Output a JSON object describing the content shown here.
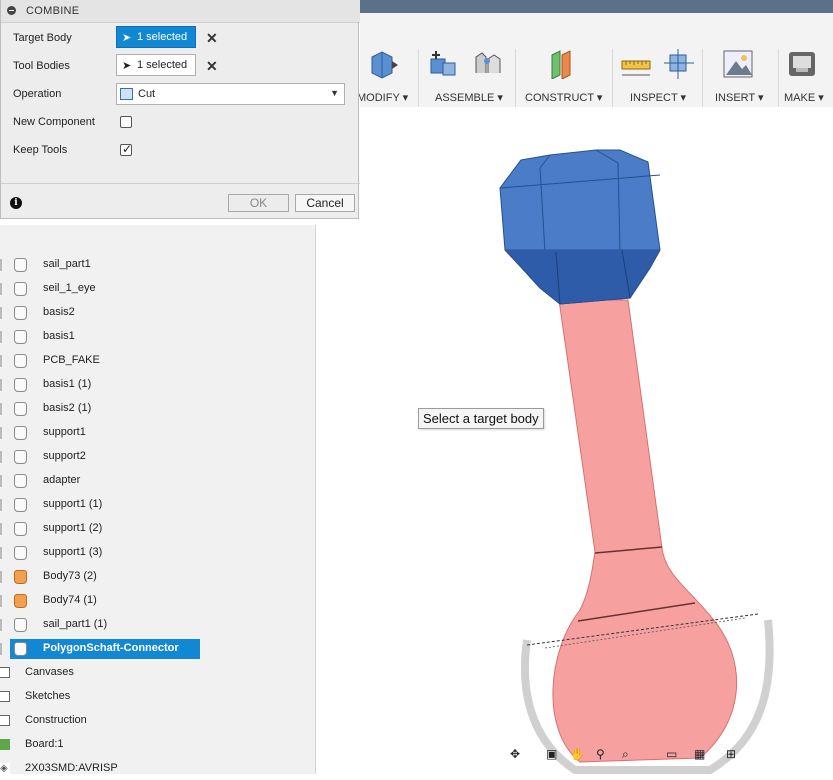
{
  "dialog": {
    "title": "COMBINE",
    "target_body_label": "Target Body",
    "target_body_value": "1 selected",
    "tool_bodies_label": "Tool Bodies",
    "tool_bodies_value": "1 selected",
    "operation_label": "Operation",
    "operation_value": "Cut",
    "new_component_label": "New Component",
    "new_component_checked": false,
    "keep_tools_label": "Keep Tools",
    "keep_tools_checked": true,
    "clear_glyph": "✕",
    "ok_label": "OK",
    "cancel_label": "Cancel",
    "info_glyph": "i"
  },
  "toolbar": {
    "groups": [
      "MODIFY ▾",
      "ASSEMBLE ▾",
      "CONSTRUCT ▾",
      "INSPECT ▾",
      "INSERT ▾",
      "MAKE ▾"
    ]
  },
  "viewport": {
    "tooltip": "Select a target body"
  },
  "browser": {
    "bodies": [
      {
        "label": "sail_part1",
        "icon": "body-icon"
      },
      {
        "label": "seil_1_eye",
        "icon": "body-icon"
      },
      {
        "label": "basis2",
        "icon": "body-icon"
      },
      {
        "label": "basis1",
        "icon": "body-icon"
      },
      {
        "label": "PCB_FAKE",
        "icon": "body-icon"
      },
      {
        "label": "basis1 (1)",
        "icon": "body-icon"
      },
      {
        "label": "basis2 (1)",
        "icon": "body-icon"
      },
      {
        "label": "support1",
        "icon": "body-icon"
      },
      {
        "label": "support2",
        "icon": "body-icon"
      },
      {
        "label": "adapter",
        "icon": "body-icon"
      },
      {
        "label": "support1 (1)",
        "icon": "body-icon"
      },
      {
        "label": "support1 (2)",
        "icon": "body-icon"
      },
      {
        "label": "support1 (3)",
        "icon": "body-icon"
      },
      {
        "label": "Body73 (2)",
        "icon": "orange-body-icon"
      },
      {
        "label": "Body74 (1)",
        "icon": "orange-body-icon"
      },
      {
        "label": "sail_part1 (1)",
        "icon": "body-icon"
      },
      {
        "label": "PolygonSchaft-Connector",
        "icon": "body-icon",
        "selected": true
      }
    ],
    "folders": [
      "Canvases",
      "Sketches",
      "Construction"
    ],
    "board_label": "Board:1",
    "last_label": "2X03SMD:AVRISP"
  },
  "colors": {
    "selection_blue": "#1287d4",
    "target_body_blue": "#3f6fc0",
    "tool_body_red": "#f29090",
    "header_bar": "#5a7188"
  }
}
